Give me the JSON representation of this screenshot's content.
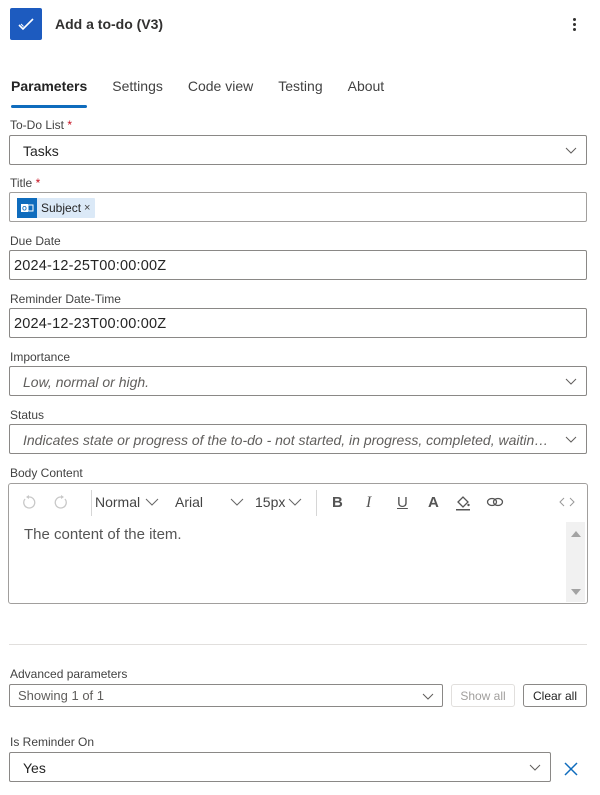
{
  "header": {
    "title": "Add a to-do (V3)",
    "icon": "checkmark-todo-icon",
    "brand_color": "#1d5bbf",
    "menu_icon": "more-vertical-icon"
  },
  "tabs": [
    {
      "label": "Parameters",
      "active": true
    },
    {
      "label": "Settings",
      "active": false
    },
    {
      "label": "Code view",
      "active": false
    },
    {
      "label": "Testing",
      "active": false
    },
    {
      "label": "About",
      "active": false
    }
  ],
  "fields": {
    "todo_list": {
      "label": "To-Do List",
      "required_mark": "*",
      "value": "Tasks"
    },
    "title": {
      "label": "Title",
      "required_mark": "*",
      "token_label": "Subject",
      "token_icon": "outlook-icon",
      "token_remove": "×"
    },
    "due_date": {
      "label": "Due Date",
      "value": "2024-12-25T00:00:00Z"
    },
    "reminder_datetime": {
      "label": "Reminder Date-Time",
      "value": "2024-12-23T00:00:00Z"
    },
    "importance": {
      "label": "Importance",
      "placeholder": "Low, normal or high."
    },
    "status": {
      "label": "Status",
      "placeholder": "Indicates state or progress of the to-do - not started, in progress, completed, waiting o..."
    },
    "body_content": {
      "label": "Body Content",
      "toolbar": {
        "format": "Normal",
        "font": "Arial",
        "size": "15px"
      },
      "value": "The content of the item."
    }
  },
  "advanced": {
    "label": "Advanced parameters",
    "value": "Showing 1 of 1",
    "show_all": "Show all",
    "clear_all": "Clear all"
  },
  "reminder_on": {
    "label": "Is Reminder On",
    "value": "Yes"
  },
  "colors": {
    "accent": "#0f6cbd",
    "required": "#c50f1f"
  }
}
